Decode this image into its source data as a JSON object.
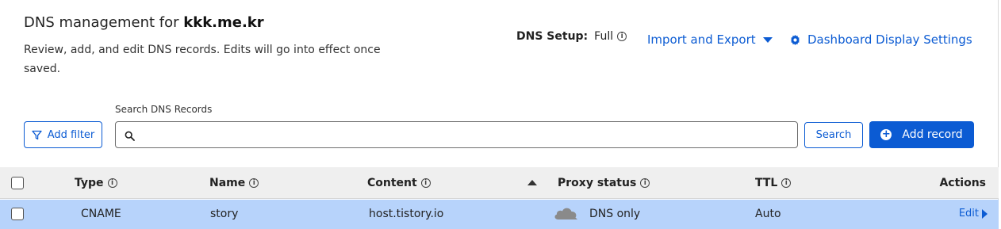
{
  "header": {
    "title_prefix": "DNS management for ",
    "domain": "kkk.me.kr",
    "description": "Review, add, and edit DNS records. Edits will go into effect once saved."
  },
  "setup": {
    "label": "DNS Setup:",
    "value": "Full"
  },
  "actions": {
    "import_export": "Import and Export",
    "dashboard_settings": "Dashboard Display Settings"
  },
  "toolbar": {
    "add_filter": "Add filter",
    "search_label": "Search DNS Records",
    "search_value": "",
    "search_button": "Search",
    "add_record": "Add record"
  },
  "table": {
    "columns": {
      "type": "Type",
      "name": "Name",
      "content": "Content",
      "proxy": "Proxy status",
      "ttl": "TTL",
      "actions": "Actions"
    },
    "rows": [
      {
        "type": "CNAME",
        "name": "story",
        "content": "host.tistory.io",
        "proxy": "DNS only",
        "ttl": "Auto",
        "action": "Edit"
      }
    ]
  },
  "colors": {
    "accent": "#0b5bd3",
    "row_selected": "#b7d3fb",
    "header_bg": "#efefef"
  }
}
